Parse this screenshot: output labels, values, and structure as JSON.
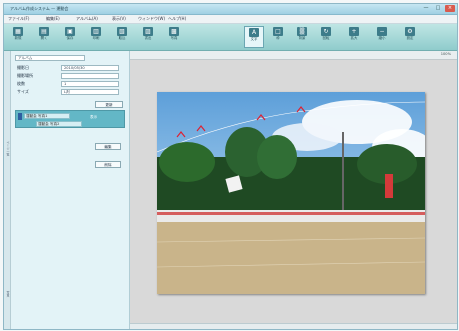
{
  "window": {
    "title": "アルバム作成システム — 運動会",
    "controls": {
      "min": "—",
      "max": "□",
      "close": "×"
    }
  },
  "menu": [
    "ファイル(F)",
    "編集(E)",
    "アルバム(A)",
    "表示(V)",
    "ウィンドウ(W)",
    "ヘルプ(H)"
  ],
  "toolbar": {
    "buttons": [
      {
        "label": "新規",
        "icon": "new-icon",
        "glyph": "▦"
      },
      {
        "label": "開く",
        "icon": "open-icon",
        "glyph": "▤"
      },
      {
        "label": "保存",
        "icon": "save-icon",
        "glyph": "▣"
      },
      {
        "label": "印刷",
        "icon": "print-icon",
        "glyph": "▥"
      },
      {
        "label": "取込",
        "icon": "import-icon",
        "glyph": "▧"
      },
      {
        "label": "書出",
        "icon": "export-icon",
        "glyph": "▨"
      },
      {
        "label": "写真",
        "icon": "photo-icon",
        "glyph": "▩"
      },
      {
        "label": "文字",
        "icon": "text-icon",
        "glyph": "A"
      },
      {
        "label": "枠",
        "icon": "frame-icon",
        "glyph": "□"
      },
      {
        "label": "背景",
        "icon": "background-icon",
        "glyph": "▒"
      },
      {
        "label": "回転",
        "icon": "rotate-icon",
        "glyph": "↻"
      },
      {
        "label": "拡大",
        "icon": "zoom-in-icon",
        "glyph": "+"
      },
      {
        "label": "縮小",
        "icon": "zoom-out-icon",
        "glyph": "−"
      },
      {
        "label": "設定",
        "icon": "settings-icon",
        "glyph": "⚙"
      }
    ]
  },
  "rail": {
    "top_label": "ページ一覧",
    "bottom_label": "写真"
  },
  "panel": {
    "field_title": "アルバム",
    "rows": [
      {
        "label": "撮影日",
        "value": "2010/05/30"
      },
      {
        "label": "撮影場所",
        "value": ""
      },
      {
        "label": "枚数",
        "value": "1"
      },
      {
        "label": "サイズ",
        "value": "L判"
      }
    ],
    "update_button": "更新",
    "group": {
      "select1": "運動会 写真1",
      "select2": "運動会 写真2",
      "option": "表示"
    },
    "edit_button": "編集",
    "delete_button": "削除"
  },
  "main": {
    "zoom": "100%"
  },
  "photo": {
    "description_free": true,
    "colors": {
      "sky": "#7db3e0",
      "trees": "#1f4a23",
      "ground": "#c9b48a"
    }
  }
}
